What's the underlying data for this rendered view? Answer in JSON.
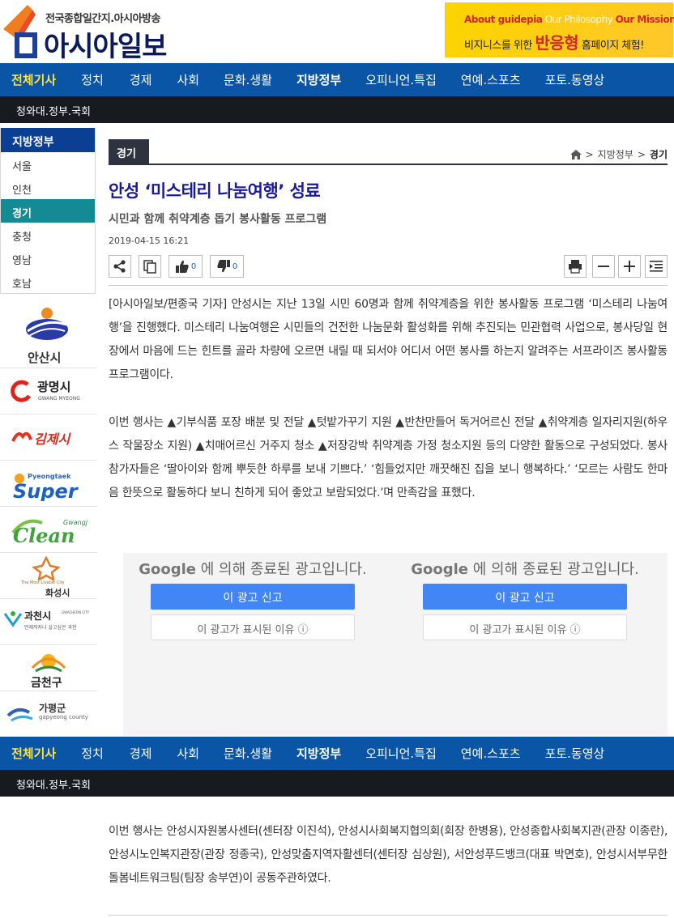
{
  "header": {
    "tagline": "전국종합일간지.아시아방송",
    "site_name": "아시아일보",
    "banner": {
      "line1_a": "About guidepia",
      "line1_b": "Our Philosophy",
      "line1_c": "Our Mission",
      "line2_a": "비지니스를 위한",
      "line2_big": "반응형",
      "line2_b": "홈페이지 체험!"
    }
  },
  "nav": {
    "items": [
      "전체기사",
      "정치",
      "경제",
      "사회",
      "문화.생활",
      "지방정부",
      "오피니언.특집",
      "연예.스포츠",
      "포토.동영상"
    ]
  },
  "subnav": {
    "label": "청와대.정부.국회"
  },
  "sidebar": {
    "title": "지방정부",
    "items": [
      "서울",
      "인천",
      "경기",
      "충청",
      "영남",
      "호남"
    ],
    "active_index": 2,
    "logos": [
      "안산시",
      "광명시",
      "김제시",
      "Pyeongtaek Super",
      "Gwangju Clean",
      "화성시",
      "과천시",
      "금천구",
      "가평군"
    ],
    "logo_sub": {
      "gwangmyeong": "GWANG MYEONG",
      "hwaseong_small": "The Most Livable City",
      "gwacheon_en": "GWACHEON CITY",
      "gwacheon_slogan": "언제까지나 살고싶은 과천",
      "gapyeong_en": "gapyeong county"
    }
  },
  "article": {
    "category": "경기",
    "breadcrumb": [
      "지방정부",
      "경기"
    ],
    "title": "안성 ‘미스테리 나눔여행’ 성료",
    "subtitle": "시민과 함께 취약계층 돕기 봉사활동 프로그램",
    "date": "2019-04-15 16:21",
    "like_count": "0",
    "dislike_count": "0",
    "para1": "[아시아일보/편종국 기자] 안성시는 지난 13일 시민 60명과 함께 취약계층을 위한 봉사활동 프로그램 ‘미스테리 나눔여행’을 진행했다. 미스테리 나눔여행은 시민들의 건전한 나눔문화 활성화를 위해 추진되는 민관협력 사업으로, 봉사당일 현장에서 마음에 드는 힌트를 골라 차량에 오르면 내릴 때 되서야 어디서 어떤 봉사를 하는지 알려주는 서프라이즈 봉사활동 프로그램이다.",
    "para2": "이번 행사는 ▲기부식품 포장 배분 및 전달 ▲텃밭가꾸기 지원 ▲반찬만들어 독거어르신 전달 ▲취약계층 일자리지원(하우스 작물장소 지원) ▲치매어르신 거주지 청소 ▲저장강박 취약계층 가정 청소지원 등의 다양한 활동으로 구성되었다. 봉사 참가자들은 ‘딸아이와 함께 뿌듯한 하루를 보내 기쁘다.’ ‘힘들었지만 깨끗해진 집을 보니 행복하다.’ ‘모르는 사람도 한마음 한뜻으로 활동하다 보니 친하게 되어 좋았고 보람되었다.’며 만족감을 표했다.",
    "para3": "이번 행사는 안성시자원봉사센터(센터장 이진석), 안성시사회복지협의회(회장 한병용), 안성종합사회복지관(관장 이종란), 안성시노인복지관장(관장 정종국), 안성맞춤지역자활센터(센터장 심상원), 서안성푸드뱅크(대표 박면호), 안성시서부무한돌봄네트워크팀(팀장 송부연)이 공동주관하였다."
  },
  "ads": [
    {
      "brand": "Google",
      "text": "에 의해 종료된 광고입니다.",
      "report": "이 광고 신고",
      "why": "이 광고가 표시된 이유 ⓘ"
    },
    {
      "brand": "Google",
      "text": "에 의해 종료된 광고입니다.",
      "report": "이 광고 신고",
      "why": "이 광고가 표시된 이유 ⓘ"
    }
  ],
  "colors": {
    "nav_bg": "#0a55a6",
    "nav_highlight": "#ffe23a",
    "subnav_bg": "#171a1f",
    "headline": "#1b1b9a",
    "sidebar_head": "#0b3f93",
    "sidebar_active": "#148a95",
    "banner_bg": "#fbd400"
  },
  "icons": [
    "home-icon",
    "share-icon",
    "copy-icon",
    "thumbs-up-icon",
    "thumbs-down-icon",
    "print-icon",
    "zoom-out-icon",
    "zoom-in-icon",
    "list-icon"
  ]
}
